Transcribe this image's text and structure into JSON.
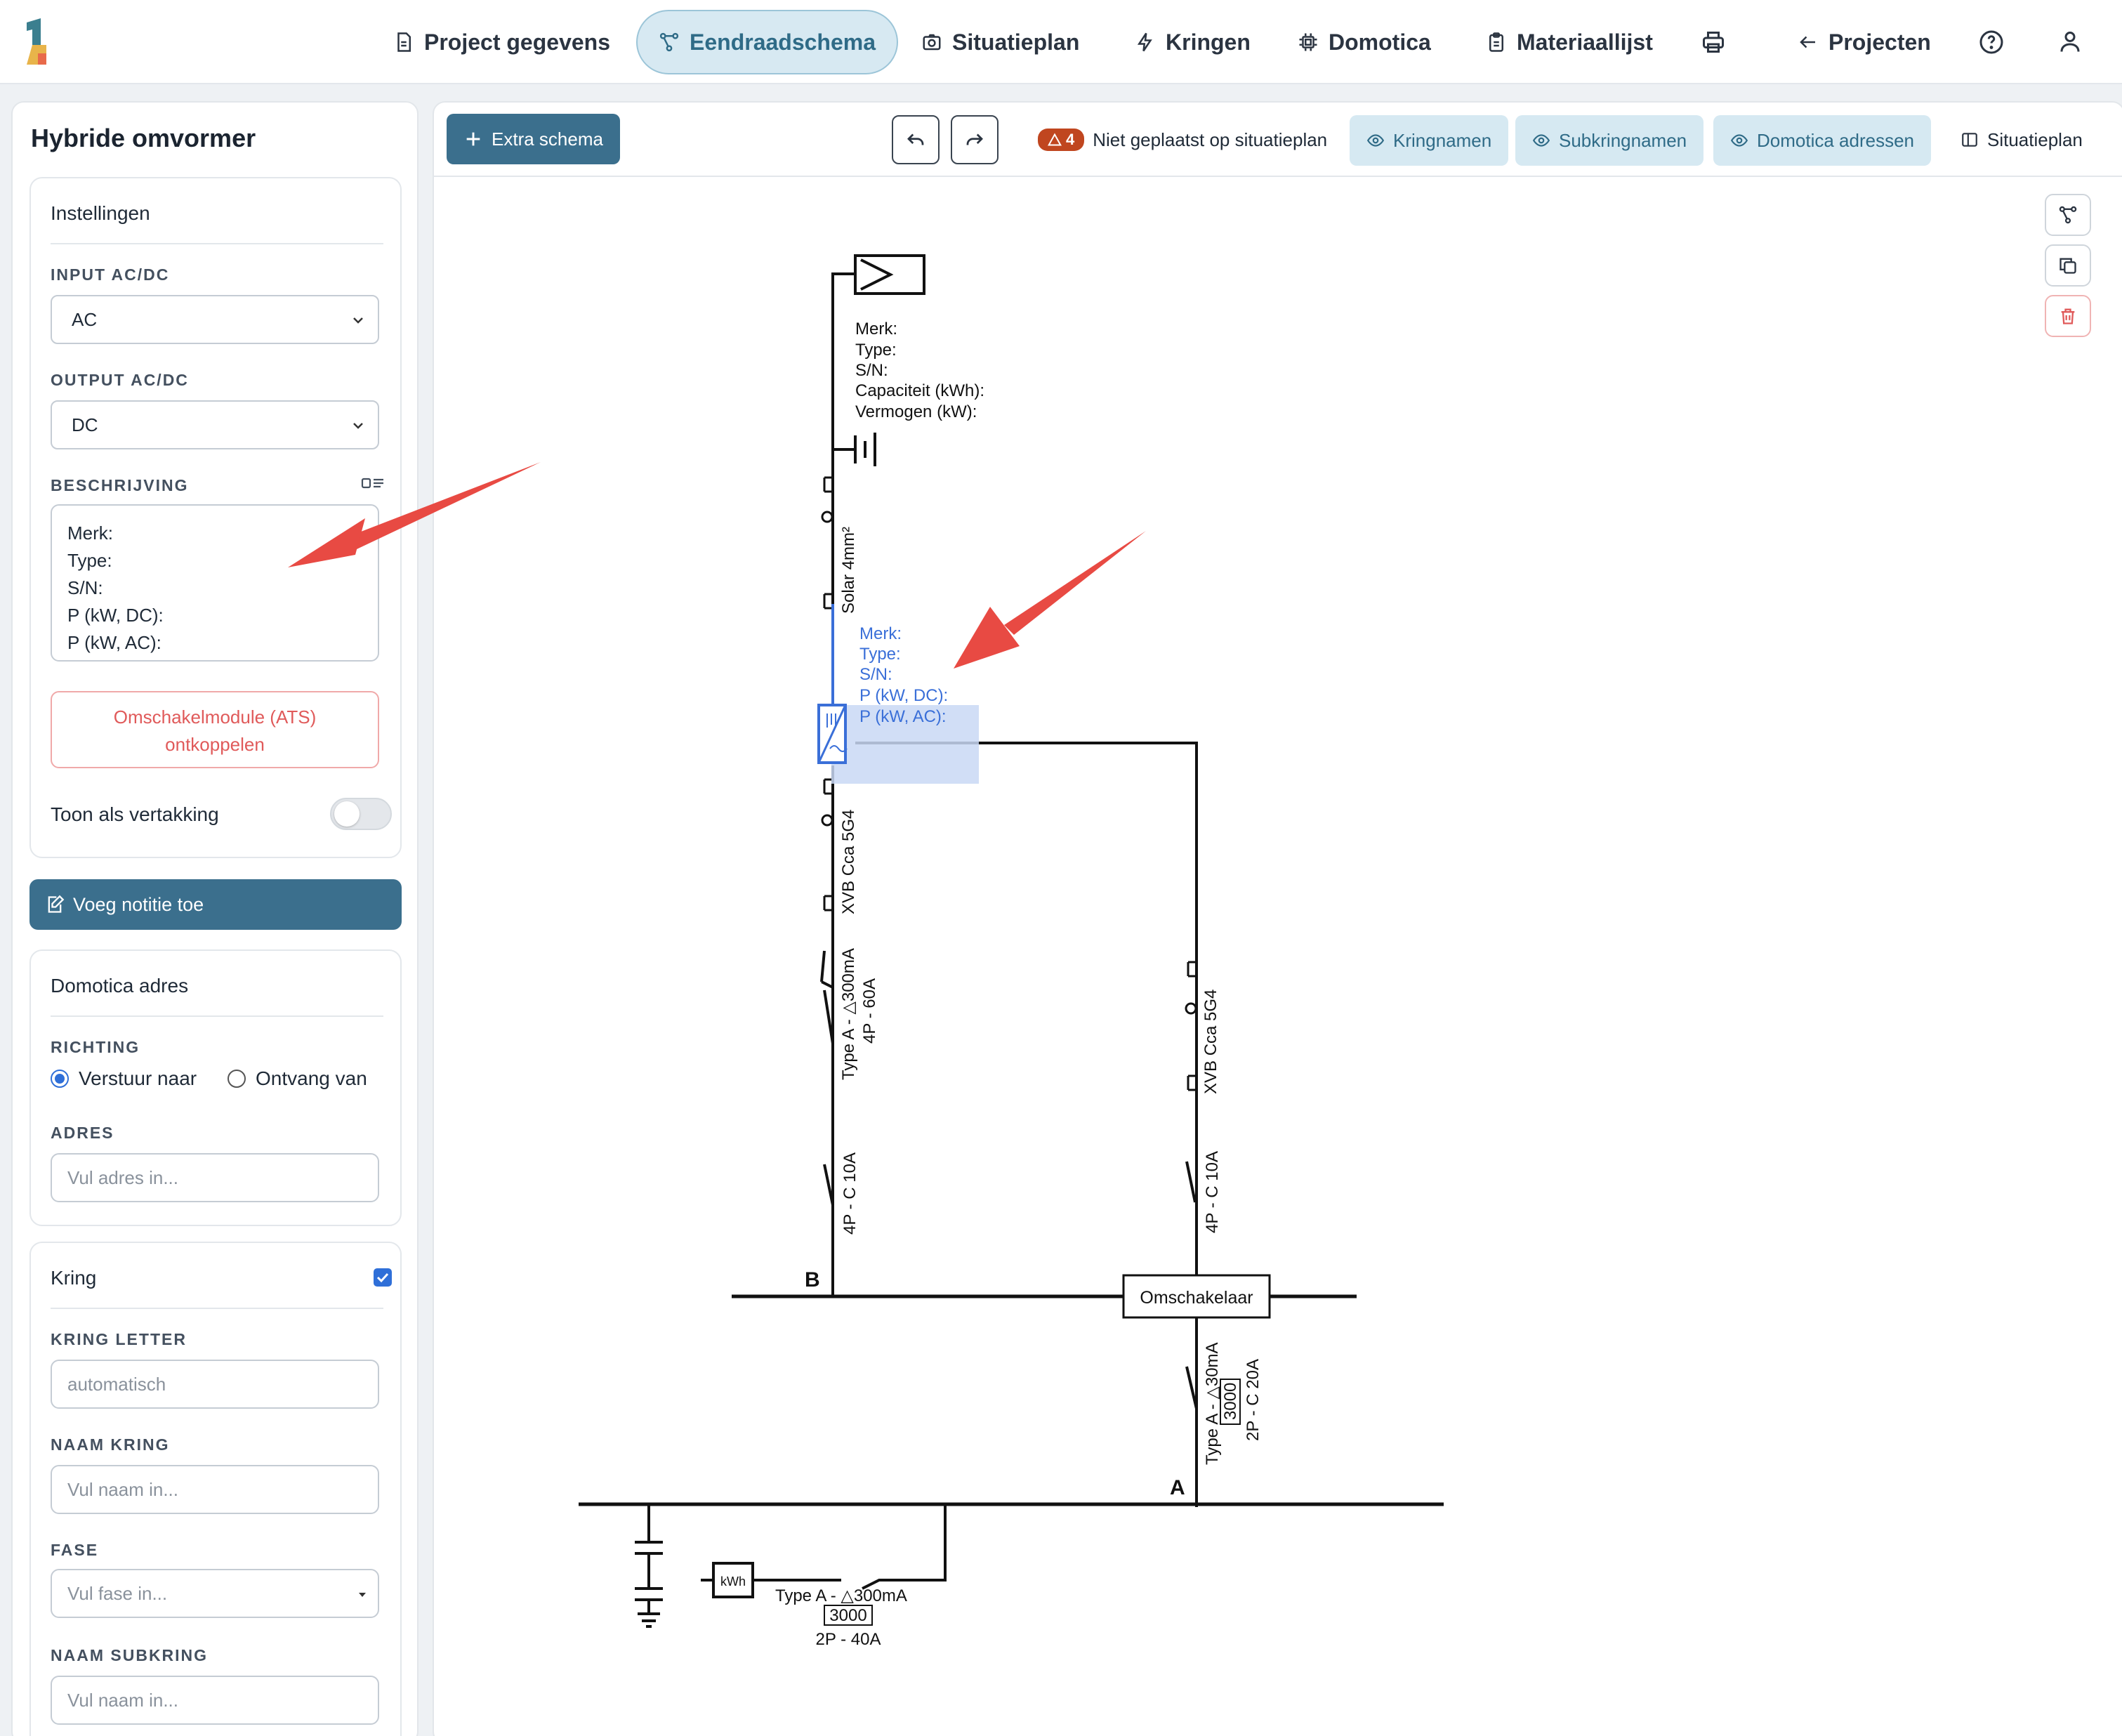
{
  "header": {
    "nav": [
      {
        "label": "Project gegevens",
        "icon": "document-icon"
      },
      {
        "label": "Eendraadschema",
        "icon": "schema-icon",
        "active": true
      },
      {
        "label": "Situatieplan",
        "icon": "camera-icon"
      },
      {
        "label": "Kringen",
        "icon": "lightning-icon"
      },
      {
        "label": "Domotica",
        "icon": "chip-icon"
      },
      {
        "label": "Materiaallijst",
        "icon": "clipboard-icon"
      }
    ],
    "projects_label": "Projecten"
  },
  "sidebar": {
    "title": "Hybride omvormer",
    "settings": {
      "heading": "Instellingen",
      "input_label": "INPUT AC/DC",
      "input_value": "AC",
      "output_label": "OUTPUT AC/DC",
      "output_value": "DC",
      "description_label": "BESCHRIJVING",
      "description_lines": [
        "Merk:",
        "Type:",
        "S/N:",
        "P (kW, DC):",
        "P (kW, AC):"
      ],
      "ats_button_line1": "Omschakelmodule (ATS)",
      "ats_button_line2": "ontkoppelen",
      "branch_label": "Toon als vertakking",
      "branch_on": false
    },
    "add_note_label": "Voeg notitie toe",
    "domotica": {
      "heading": "Domotica adres",
      "direction_label": "RICHTING",
      "send_label": "Verstuur naar",
      "receive_label": "Ontvang van",
      "address_label": "ADRES",
      "address_placeholder": "Vul adres in..."
    },
    "circuit": {
      "heading": "Kring",
      "checked": true,
      "letter_label": "KRING LETTER",
      "letter_placeholder": "automatisch",
      "name_label": "NAAM KRING",
      "name_placeholder": "Vul naam in...",
      "phase_label": "FASE",
      "phase_placeholder": "Vul fase in...",
      "subname_label": "NAAM SUBKRING",
      "subname_placeholder": "Vul naam in..."
    }
  },
  "toolbar": {
    "extra_schema": "Extra schema",
    "warning_count": "4",
    "warning_text": "Niet geplaatst op situatieplan",
    "circuit_names": "Kringnamen",
    "subcircuit_names": "Subkringnamen",
    "domotica_addresses": "Domotica adressen",
    "site_plan": "Situatieplan"
  },
  "diagram": {
    "battery_labels": [
      "Merk:",
      "Type:",
      "S/N:",
      "Capaciteit (kWh):",
      "Vermogen (kW):"
    ],
    "cable_top": "Solar 4mm²",
    "inverter_labels": [
      "Merk:",
      "Type:",
      "S/N:",
      "P (kW, DC):",
      "P (kW, AC):"
    ],
    "cable_left": "XVB Cca 5G4",
    "cable_right": "XVB Cca 5G4",
    "rcd_left_line1": "Type A -  △300mA",
    "rcd_left_line2": "4P - 60A",
    "breaker_left": "4P - C 10A",
    "breaker_right": "4P - C 10A",
    "bus_b": "B",
    "switch_label": "Omschakelaar",
    "rcd_a_line1": "Type A -  △30mA",
    "rcd_a_box": "3000",
    "rcd_a_line2": "2P - C 20A",
    "bus_a": "A",
    "meter_label": "kWh",
    "main_rcd_line1": "Type A -  △300mA",
    "main_rcd_box": "3000",
    "main_rcd_line2": "2P - 40A"
  },
  "colors": {
    "accent": "#3b6f8d",
    "highlight": "#3a6fd8",
    "warning": "#c0461f",
    "annotation_arrow": "#e84a43"
  }
}
